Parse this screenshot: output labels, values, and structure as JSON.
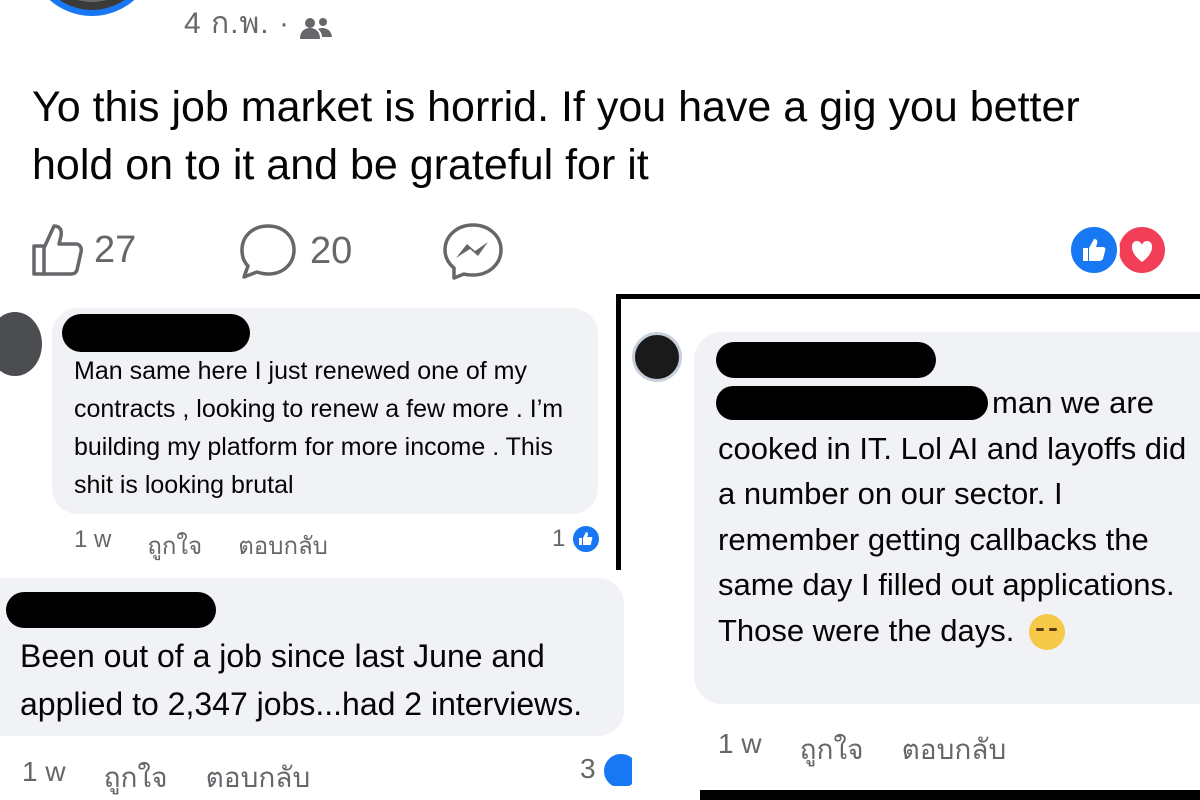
{
  "post": {
    "date": "4 ก.พ. ·",
    "audience_icon": "friends-icon",
    "text": "Yo this job market is horrid. If you have a gig you better hold on to it and be grateful for it",
    "like_count": "27",
    "comment_count": "20",
    "reactions": [
      "like",
      "love"
    ]
  },
  "comments": [
    {
      "text": "Man same here I just renewed one of my contracts , looking to renew a few more . I’m building my platform for more income . This shit is looking brutal",
      "time": "1 w",
      "like_label": "ถูกใจ",
      "reply_label": "ตอบกลับ",
      "reaction_count": "1"
    },
    {
      "text_line1": "Been out of a job since last June and",
      "text_line2": "applied to 2,347 jobs...had 2 interviews.",
      "time": "1 w",
      "like_label": "ถูกใจ",
      "reply_label": "ตอบกลับ",
      "reaction_count": "3"
    },
    {
      "text_first": "man we are",
      "text_rest": "cooked in IT. Lol AI and layoffs did a number on our sector. I remember getting callbacks the same day I filled out applications. Those were the days.",
      "emoji": "sleeping-face-emoji",
      "time": "1 w",
      "like_label": "ถูกใจ",
      "reply_label": "ตอบกลับ"
    }
  ],
  "colors": {
    "accent": "#1877f2",
    "love": "#f33e58",
    "bubble": "#f0f2f5",
    "meta_text": "#65676b"
  }
}
